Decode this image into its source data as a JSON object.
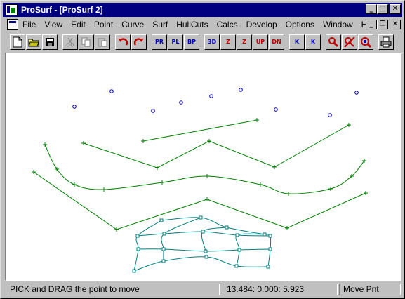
{
  "window": {
    "title": "ProSurf - [ProSurf 2]",
    "controls": {
      "minimize": "_",
      "maximize": "□",
      "close": "✕"
    }
  },
  "menubar": {
    "items": [
      "File",
      "View",
      "Edit",
      "Point",
      "Curve",
      "Surf",
      "HullCuts",
      "Calcs",
      "Develop",
      "Options",
      "Window",
      "Help"
    ],
    "doc_controls": {
      "minimize": "_",
      "restore": "❐",
      "close": "✕"
    }
  },
  "toolbar": {
    "buttons": [
      {
        "name": "new-file",
        "icon": "new-file-icon"
      },
      {
        "name": "open-file",
        "icon": "open-folder-icon"
      },
      {
        "name": "save-file",
        "icon": "save-disk-icon"
      },
      {
        "name": "cut",
        "icon": "scissors-icon",
        "disabled": true
      },
      {
        "name": "copy",
        "icon": "copy-icon",
        "disabled": true
      },
      {
        "name": "paste",
        "icon": "paste-icon",
        "disabled": true
      },
      {
        "name": "undo",
        "icon": "undo-arrow-icon"
      },
      {
        "name": "redo",
        "icon": "redo-arrow-icon"
      },
      {
        "name": "view-pr",
        "label": "PR"
      },
      {
        "name": "view-pl",
        "label": "PL"
      },
      {
        "name": "view-bp",
        "label": "BP"
      },
      {
        "name": "view-3d",
        "label": "3D"
      },
      {
        "name": "rotate-z-left",
        "label": "Z"
      },
      {
        "name": "rotate-z-right",
        "label": "Z"
      },
      {
        "name": "up",
        "label": "UP"
      },
      {
        "name": "down",
        "label": "DN"
      },
      {
        "name": "k-up",
        "label": "K"
      },
      {
        "name": "k-down",
        "label": "K"
      },
      {
        "name": "zoom",
        "icon": "magnifier-icon"
      },
      {
        "name": "zoom-fit",
        "icon": "zoom-cross-icon"
      },
      {
        "name": "zoom-pan",
        "icon": "zoom-pan-icon"
      },
      {
        "name": "print",
        "icon": "printer-icon"
      }
    ]
  },
  "status": {
    "message": "PICK and DRAG the point to move",
    "coords": "13.484:  0.000:  5.923",
    "mode": "Move Pnt"
  },
  "colors": {
    "curve": "#008000",
    "surface": "#008080",
    "point": "#0000c0"
  }
}
